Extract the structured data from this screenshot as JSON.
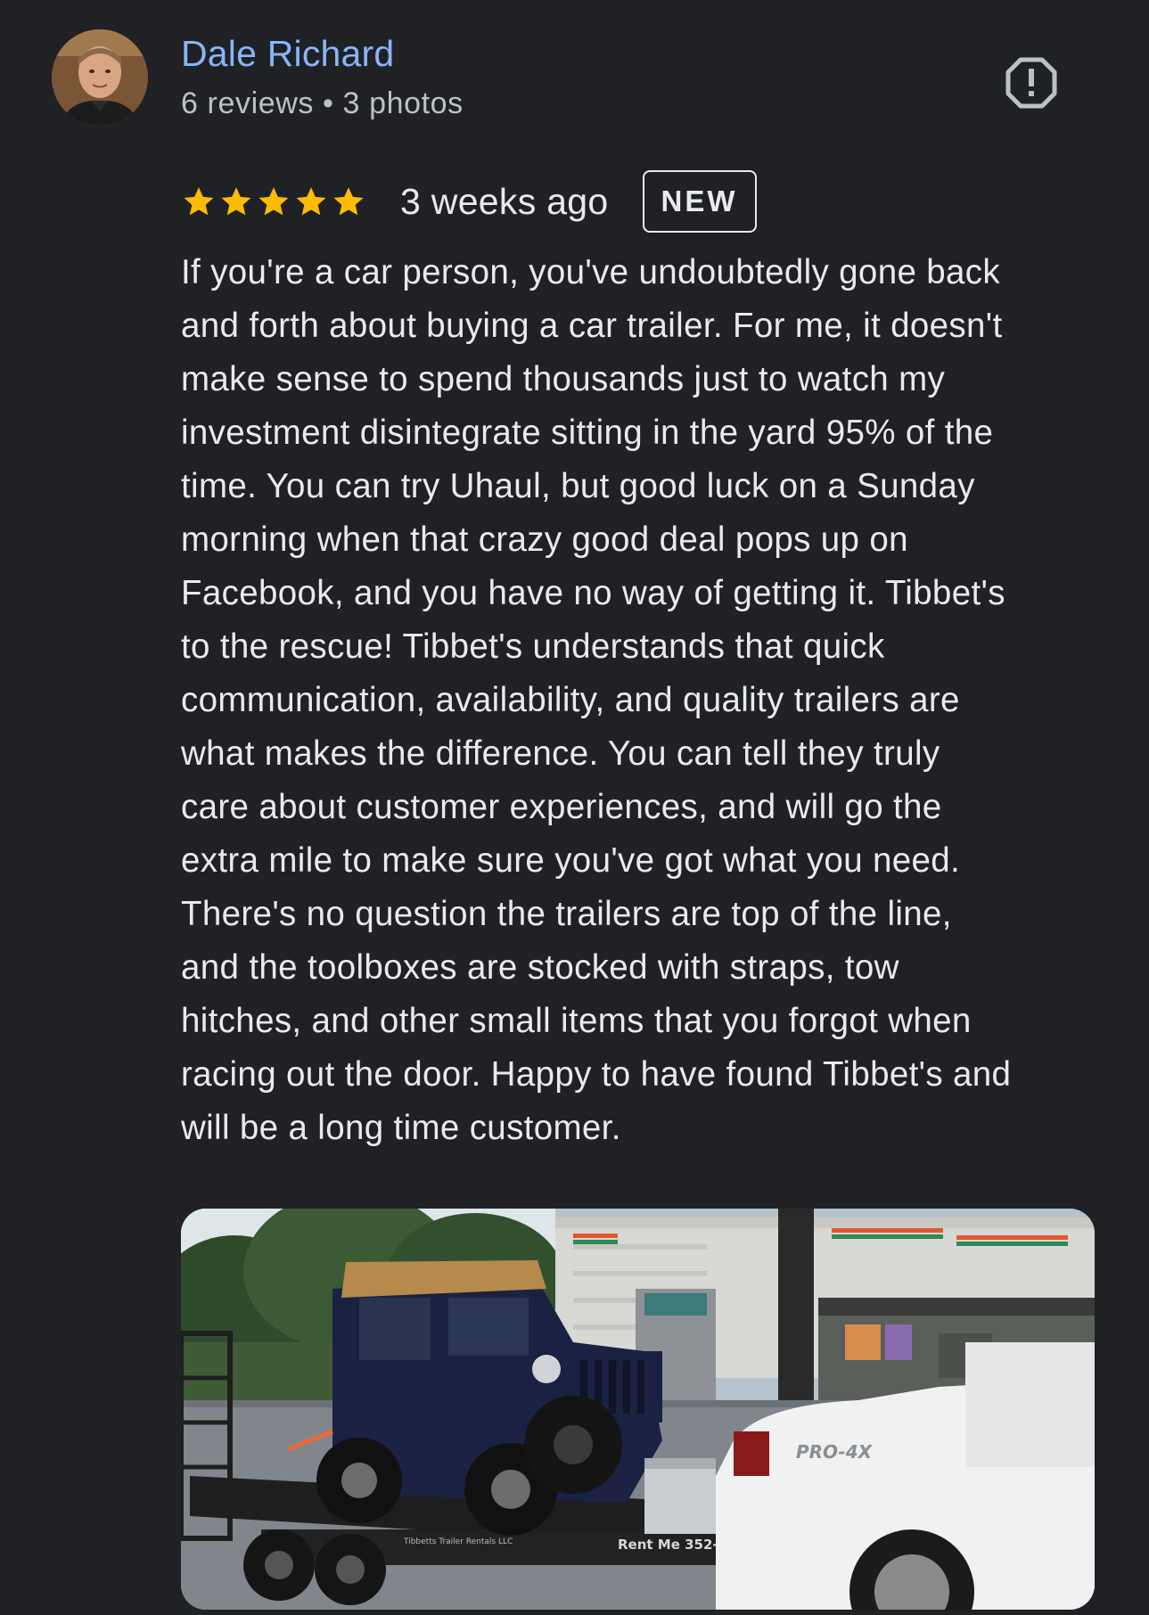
{
  "reviewer": {
    "name": "Dale Richard",
    "reviews": "6 reviews",
    "separator": "•",
    "photos": "3 photos"
  },
  "rating": {
    "stars": 5,
    "max": 5,
    "star_color": "#fbbc04"
  },
  "time_ago": "3 weeks ago",
  "badge": "NEW",
  "review_text": "If you're a car person, you've undoubtedly gone back\nand forth about buying a car trailer. For me, it doesn't\nmake sense to spend thousands just to watch my\ninvestment disintegrate sitting in the yard 95% of the\ntime. You can try Uhaul, but good luck on a Sunday\nmorning when that crazy good deal pops up on\nFacebook, and you have no way of getting it. Tibbet's\nto the rescue! Tibbet's understands that quick\ncommunication, availability, and quality trailers are\nwhat makes the difference. You can tell they truly\ncare about customer experiences, and will go the\nextra mile to make sure you've got what you need.\nThere's no question the trailers are top of the line,\nand the toolboxes are stocked with straps, tow\nhitches, and other small items that you forgot when\nracing out the door. Happy to have found Tibbet's and\nwill be a long time customer.",
  "photo": {
    "trailer_text": "Rent Me 352-275",
    "trailer_brand": "Tibbetts Trailer Rentals LLC",
    "truck_badge": "PRO-4X"
  },
  "colors": {
    "background": "#202124",
    "name": "#8ab4f8",
    "text": "#e8eaed",
    "meta": "#bdc1c6"
  }
}
